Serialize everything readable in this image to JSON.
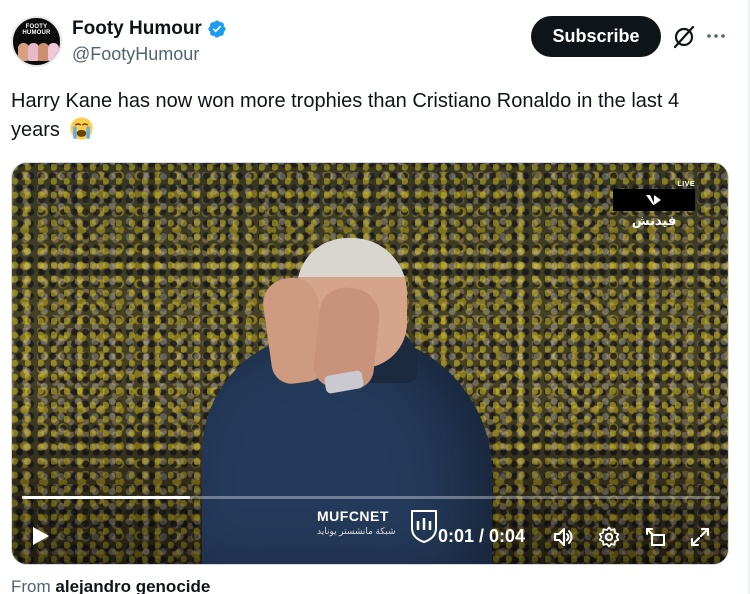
{
  "tweet": {
    "author": {
      "display_name": "Footy Humour",
      "handle": "@FootyHumour",
      "verified": true,
      "avatar_text": "FOOTY HUMOUR"
    },
    "subscribe_label": "Subscribe",
    "text": "Harry Kane has now won more trophies than Cristiano Ronaldo in the last 4 years",
    "emoji": "loudly-crying-face",
    "icons": {
      "grok": "grok-icon",
      "more": "more-icon",
      "verified": "verified-badge-icon"
    },
    "colors": {
      "accent": "#1d9bf0",
      "button_bg": "#0f1419",
      "secondary_text": "#536471"
    }
  },
  "video": {
    "live_label": "LIVE",
    "broadcaster_arabic": "فيدتش",
    "watermark_title": "MUFCNET",
    "watermark_subtitle": "شبكة مانشستر يونايد",
    "time_display": "0:01 / 0:04",
    "progress_fraction": 0.24,
    "controls": [
      "play-icon",
      "volume-icon",
      "settings-icon",
      "pip-icon",
      "fullscreen-icon"
    ]
  },
  "from": {
    "prefix": "From",
    "user": "alejandro genocide"
  }
}
